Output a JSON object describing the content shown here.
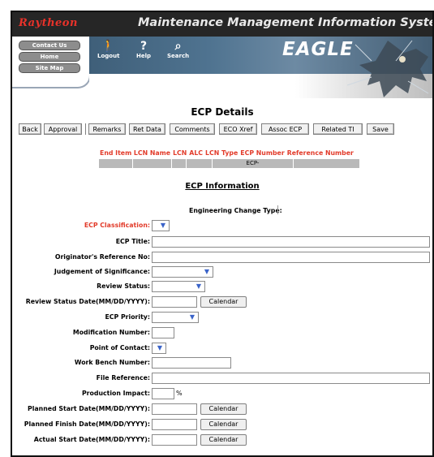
{
  "header": {
    "brand": "Raytheon",
    "app_title": "Maintenance Management Information System",
    "logo_word": "EAGLE",
    "nav": [
      "Contact Us",
      "Home",
      "Site Map"
    ],
    "toolbar": {
      "logout": "Logout",
      "help": "Help",
      "search": "Search"
    }
  },
  "page_title": "ECP Details",
  "buttons": [
    "Back",
    "Approval",
    "Remarks",
    "Ret Data",
    "Comments",
    "ECO Xref",
    "Assoc ECP",
    "Related TI",
    "Save"
  ],
  "grid": {
    "headers": [
      "End Item LCN Name",
      "LCN",
      "ALC",
      "LCN Type",
      "ECP Number",
      "Reference Number"
    ],
    "row": [
      "",
      "",
      "",
      "",
      "ECP-",
      ""
    ]
  },
  "section_title": "ECP Information",
  "engineering_change_type_label": "Engineering Change Type:",
  "fields": [
    {
      "label": "ECP Classification:"
    },
    {
      "label": "ECP Title:"
    },
    {
      "label": "Originator's Reference No:"
    },
    {
      "label": "Judgement of Significance:"
    },
    {
      "label": "Review Status:"
    },
    {
      "label": "Review Status Date(MM/DD/YYYY):"
    },
    {
      "label": "ECP Priority:"
    },
    {
      "label": "Modification Number:"
    },
    {
      "label": "Point of Contact:"
    },
    {
      "label": "Work Bench Number:"
    },
    {
      "label": "File Reference:"
    },
    {
      "label": "Production Impact:"
    },
    {
      "label": "Planned Start Date(MM/DD/YYYY):"
    },
    {
      "label": "Planned Finish Date(MM/DD/YYYY):"
    },
    {
      "label": "Actual Start Date(MM/DD/YYYY):"
    }
  ],
  "calendar_label": "Calendar",
  "percent_sign": "%",
  "colors": {
    "brand_red": "#e23b2a",
    "banner_blue": "#4f7390"
  }
}
